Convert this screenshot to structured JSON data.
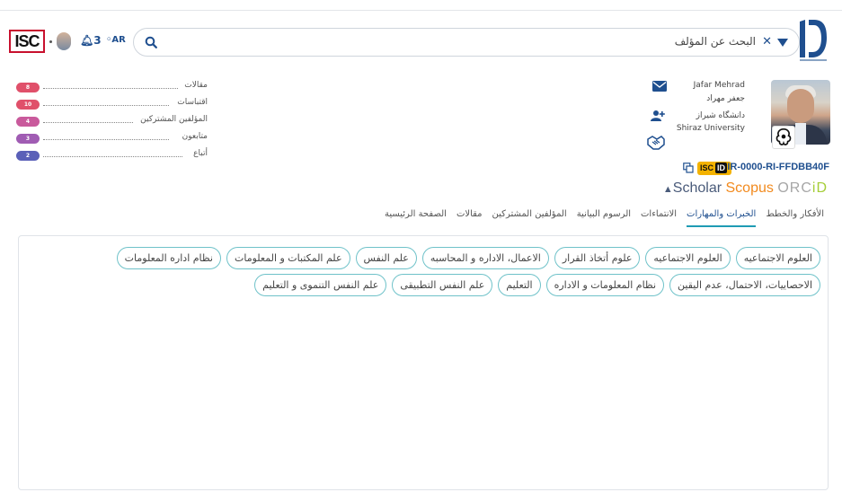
{
  "header": {
    "search_placeholder": "البحث عن المؤلف",
    "clear_icon": "close-icon",
    "notification_count": "3",
    "language": "AR",
    "isc_logo_text": "ISC"
  },
  "stats": [
    {
      "count": "8",
      "label": "مقالات",
      "color": "#e0506a"
    },
    {
      "count": "10",
      "label": "اقتباسات",
      "color": "#e0506a"
    },
    {
      "count": "4",
      "label": "المؤلفين المشتركين",
      "color": "#c95a9c"
    },
    {
      "count": "3",
      "label": "متابعون",
      "color": "#a05cb3"
    },
    {
      "count": "2",
      "label": "أتباع",
      "color": "#5a60b8"
    }
  ],
  "profile": {
    "name_en": "Jafar Mehrad",
    "name_fa": "جعفر مهراد",
    "university_fa": "دانشگاه شیراز",
    "university_en": "Shiraz University",
    "isc_badge": "ISC",
    "isc_badge_id": "ID",
    "isc_id": "IR-0000-RI-FFDBB40F",
    "scholar": "Scholar",
    "scopus": "Scopus",
    "orcid_pre": "ORC",
    "orcid_id": "iD"
  },
  "tabs": [
    {
      "label": "الصفحة الرئيسية",
      "active": false
    },
    {
      "label": "مقالات",
      "active": false
    },
    {
      "label": "المؤلفين المشتركين",
      "active": false
    },
    {
      "label": "الرسوم البيانية",
      "active": false
    },
    {
      "label": "الانتماءات",
      "active": false
    },
    {
      "label": "الخبرات والمهارات",
      "active": true
    },
    {
      "label": "الأفكار والخطط",
      "active": false
    }
  ],
  "skills": [
    "العلوم الاجتماعيه",
    "العلوم الاجتماعيه",
    "علوم أتخاذ القرار",
    "الاعمال، الاداره و المحاسبه",
    "علم النفس",
    "علم المكتبات و المعلومات",
    "نظام اداره المعلومات",
    "الاحصاييات، الاحتمال، عدم اليقين",
    "نظام المعلومات و الاداره",
    "التعليم",
    "علم النفس التطبيقى",
    "علم النفس التنموى و التعليم"
  ],
  "colors": {
    "accent": "#1f4f8f",
    "tab_underline": "#1f9bb4",
    "chip_border": "#6fc2c9"
  }
}
